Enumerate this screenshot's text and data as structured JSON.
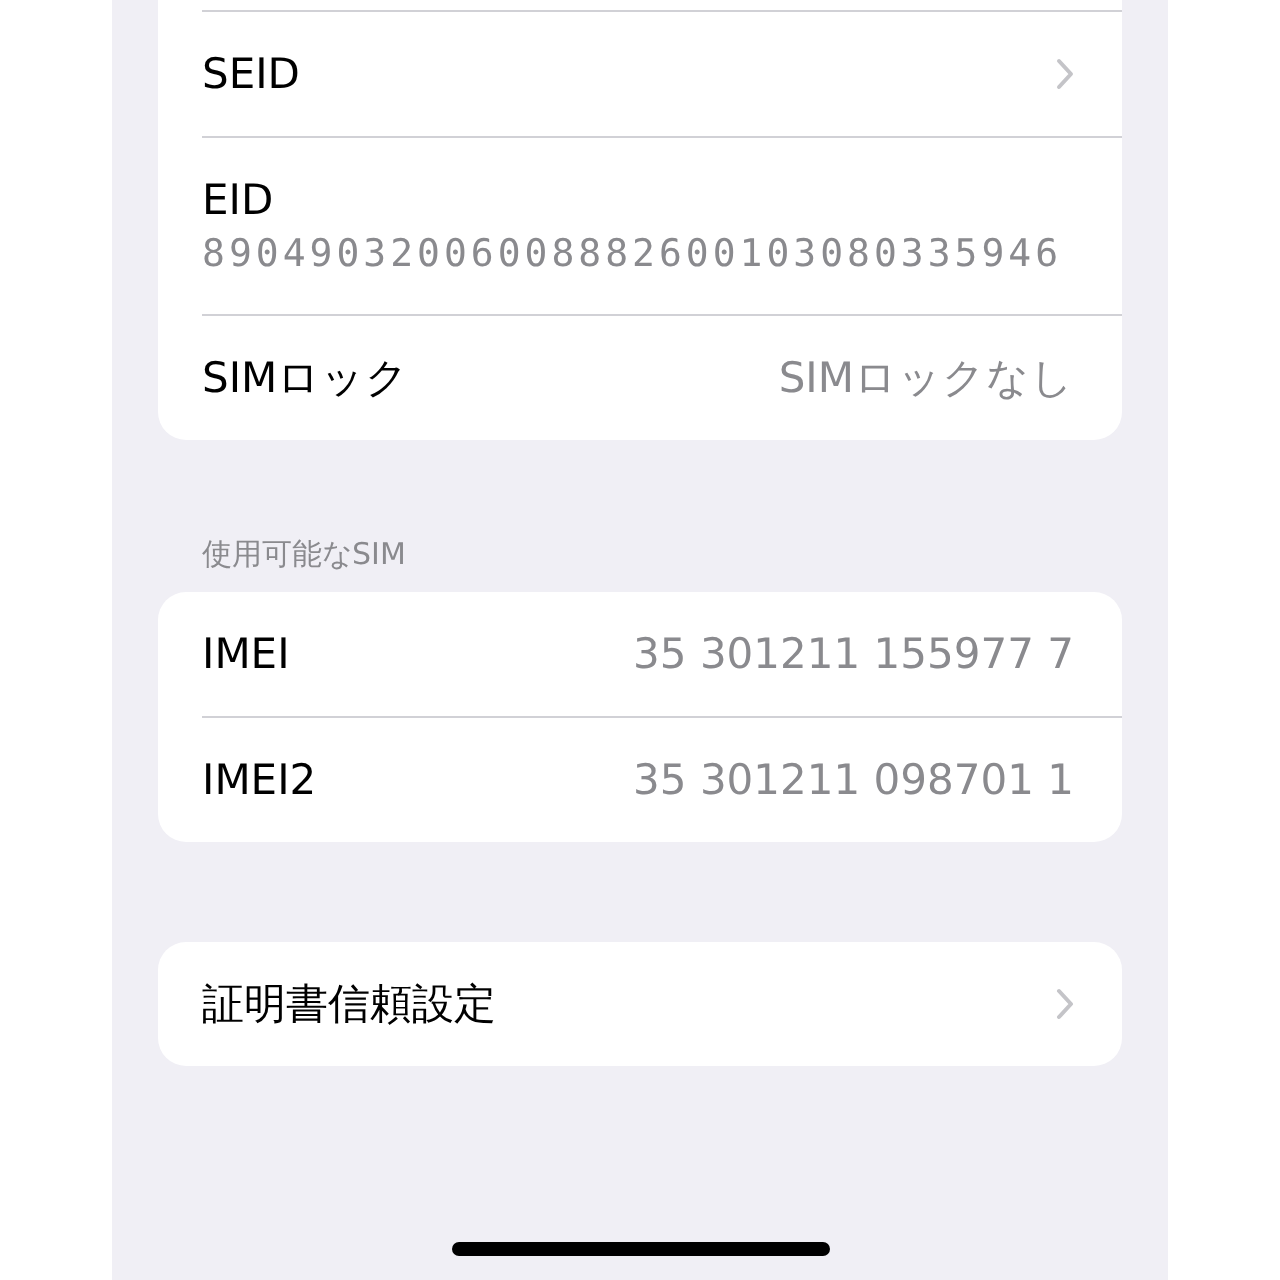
{
  "groups": [
    {
      "rows": [
        {
          "kind": "link",
          "label": "SEID"
        },
        {
          "kind": "stacked",
          "label": "EID",
          "value": "89049032006008882600103080335946"
        },
        {
          "kind": "value",
          "label": "SIMロック",
          "value": "SIMロックなし"
        }
      ]
    },
    {
      "header": "使用可能なSIM",
      "rows": [
        {
          "kind": "value",
          "label": "IMEI",
          "value": "35 301211 155977 7"
        },
        {
          "kind": "value",
          "label": "IMEI2",
          "value": "35 301211 098701 1"
        }
      ]
    },
    {
      "rows": [
        {
          "kind": "link",
          "label": "証明書信頼設定"
        }
      ]
    }
  ]
}
